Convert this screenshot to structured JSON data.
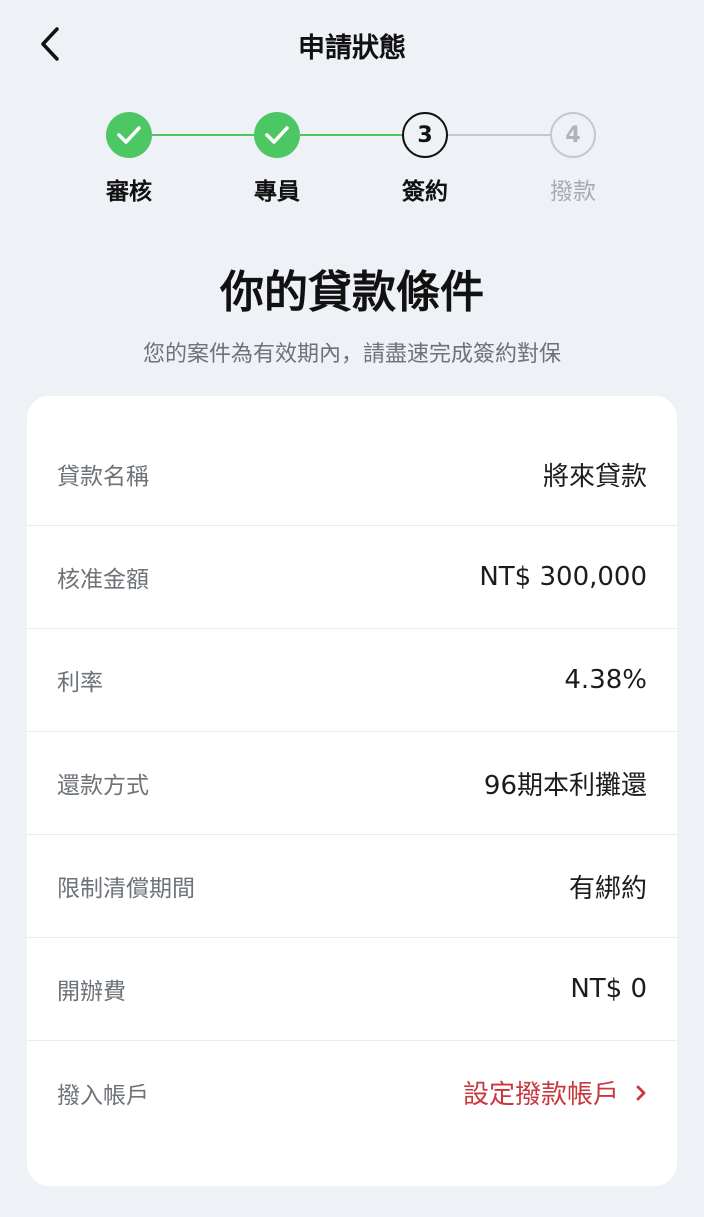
{
  "header": {
    "title": "申請狀態"
  },
  "stepper": {
    "steps": [
      {
        "label": "審核",
        "state": "done"
      },
      {
        "label": "專員",
        "state": "done"
      },
      {
        "label": "簽約",
        "number": "3",
        "state": "current"
      },
      {
        "label": "撥款",
        "number": "4",
        "state": "pending"
      }
    ]
  },
  "main": {
    "title": "你的貸款條件",
    "subtitle": "您的案件為有效期內，請盡速完成簽約對保"
  },
  "details": {
    "rows": [
      {
        "label": "貸款名稱",
        "value": "將來貸款"
      },
      {
        "label": "核准金額",
        "value": "NT$ 300,000"
      },
      {
        "label": "利率",
        "value": "4.38%"
      },
      {
        "label": "還款方式",
        "value": "96期本利攤還"
      },
      {
        "label": "限制清償期間",
        "value": "有綁約"
      },
      {
        "label": "開辦費",
        "value": "NT$ 0"
      },
      {
        "label": "撥入帳戶",
        "link": "設定撥款帳戶"
      }
    ]
  },
  "colors": {
    "done": "#4cc764",
    "link": "#c8383f",
    "background": "#eef1f5"
  }
}
